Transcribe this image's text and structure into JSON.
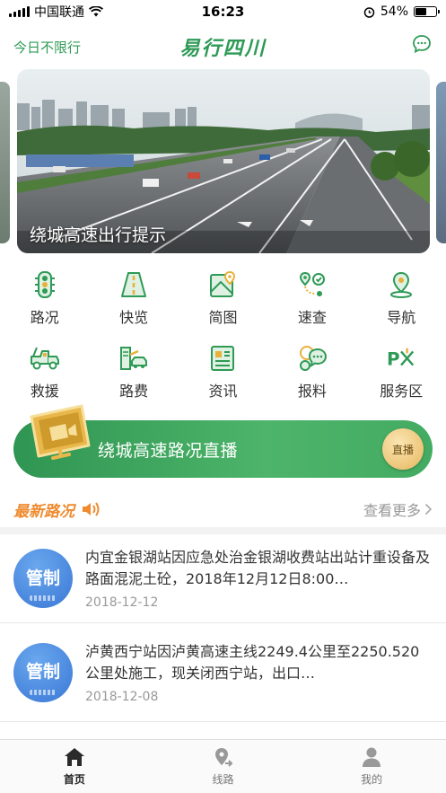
{
  "status_bar": {
    "carrier": "中国联通",
    "time": "16:23",
    "battery": "54%",
    "battery_level": 0.54
  },
  "header": {
    "left_label": "今日不限行",
    "title": "易行四川",
    "right_icon": "message-icon"
  },
  "banner": {
    "caption": "绕城高速出行提示"
  },
  "grid": {
    "items": [
      {
        "label": "路况",
        "icon": "traffic-light-icon"
      },
      {
        "label": "快览",
        "icon": "road-icon"
      },
      {
        "label": "简图",
        "icon": "map-icon"
      },
      {
        "label": "速查",
        "icon": "route-search-icon"
      },
      {
        "label": "导航",
        "icon": "location-pin-icon"
      },
      {
        "label": "救援",
        "icon": "tow-truck-icon"
      },
      {
        "label": "路费",
        "icon": "toll-icon"
      },
      {
        "label": "资讯",
        "icon": "news-icon"
      },
      {
        "label": "报料",
        "icon": "chat-report-icon"
      },
      {
        "label": "服务区",
        "icon": "service-area-icon"
      }
    ]
  },
  "live": {
    "text": "绕城高速路况直播",
    "button": "直播"
  },
  "latest": {
    "title": "最新路况",
    "more": "查看更多"
  },
  "news": [
    {
      "badge": "管制",
      "text": "内宜金银湖站因应急处治金银湖收费站出站计重设备及路面混泥土砼，2018年12月12日8:00…",
      "date": "2018-12-12"
    },
    {
      "badge": "管制",
      "text": "泸黄西宁站因泸黄高速主线2249.4公里至2250.520公里处施工，现关闭西宁站，出口…",
      "date": "2018-12-08"
    }
  ],
  "tabs": [
    {
      "label": "首页",
      "icon": "home-icon",
      "active": true
    },
    {
      "label": "线路",
      "icon": "route-icon",
      "active": false
    },
    {
      "label": "我的",
      "icon": "user-icon",
      "active": false
    }
  ],
  "colors": {
    "brand_green": "#2e9a56",
    "accent_orange": "#ef8a2e",
    "badge_blue": "#3a78d6"
  }
}
